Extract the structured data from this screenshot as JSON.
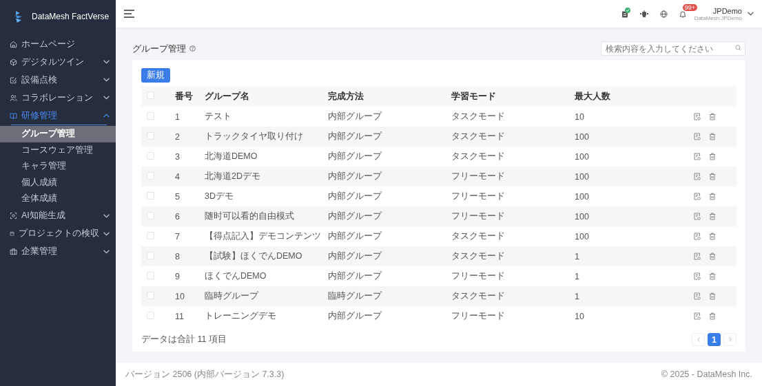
{
  "app": {
    "name": "DataMesh FactVerse"
  },
  "sidebar": {
    "items": [
      {
        "label": "ホームページ"
      },
      {
        "label": "デジタルツイン",
        "expanded": false
      },
      {
        "label": "設備点検",
        "expanded": false
      },
      {
        "label": "コラボレーション",
        "expanded": false
      },
      {
        "label": "研修管理",
        "expanded": true,
        "children": [
          {
            "label": "グループ管理",
            "selected": true
          },
          {
            "label": "コースウェア管理",
            "selected": false
          },
          {
            "label": "キャラ管理",
            "selected": false
          },
          {
            "label": "個人成績",
            "selected": false
          },
          {
            "label": "全体成績",
            "selected": false
          }
        ]
      },
      {
        "label": "AI知能生成",
        "expanded": false
      },
      {
        "label": "プロジェクトの検収",
        "expanded": false
      },
      {
        "label": "企業管理",
        "expanded": false
      }
    ]
  },
  "header": {
    "notification_badge": "99+",
    "task_done": true,
    "user": {
      "name": "JPDemo",
      "account": "DataMesh.JPDemo"
    }
  },
  "page": {
    "title": "グループ管理",
    "search": {
      "placeholder": "検索内容を入力してください"
    },
    "new_button": "新規"
  },
  "table": {
    "all_checked": false,
    "columns": [
      "番号",
      "グループ名",
      "完成方法",
      "学習モード",
      "最大人数"
    ],
    "rows": [
      {
        "checked": false,
        "cells": [
          "1",
          "テスト",
          "内部グループ",
          "タスクモード",
          "10"
        ]
      },
      {
        "checked": false,
        "cells": [
          "2",
          "トラックタイヤ取り付け",
          "内部グループ",
          "タスクモード",
          "100"
        ]
      },
      {
        "checked": false,
        "cells": [
          "3",
          "北海道DEMO",
          "内部グループ",
          "タスクモード",
          "100"
        ]
      },
      {
        "checked": false,
        "cells": [
          "4",
          "北海道2Dデモ",
          "内部グループ",
          "フリーモード",
          "100"
        ]
      },
      {
        "checked": false,
        "cells": [
          "5",
          "3Dデモ",
          "内部グループ",
          "フリーモード",
          "100"
        ]
      },
      {
        "checked": false,
        "cells": [
          "6",
          "随时可以看的自由模式",
          "内部グループ",
          "フリーモード",
          "100"
        ]
      },
      {
        "checked": false,
        "cells": [
          "7",
          "【得点記入】デモコンテンツ",
          "内部グループ",
          "タスクモード",
          "100"
        ]
      },
      {
        "checked": false,
        "cells": [
          "8",
          "【試験】ほくでんDEMO",
          "内部グループ",
          "タスクモード",
          "1"
        ]
      },
      {
        "checked": false,
        "cells": [
          "9",
          "ほくでんDEMO",
          "内部グループ",
          "フリーモード",
          "1"
        ]
      },
      {
        "checked": false,
        "cells": [
          "10",
          "臨時グループ",
          "臨時グループ",
          "タスクモード",
          "1"
        ]
      },
      {
        "checked": false,
        "cells": [
          "11",
          "トレーニングデモ",
          "内部グループ",
          "フリーモード",
          "10"
        ]
      }
    ]
  },
  "pagination": {
    "total": "データは合計 11 項目",
    "pages": [
      {
        "label": "1",
        "selected": true
      }
    ]
  },
  "footer": {
    "version": "バージョン 2506 (内部バージョン 7.3.3)",
    "copyright": "© 2025 - DataMesh Inc."
  }
}
